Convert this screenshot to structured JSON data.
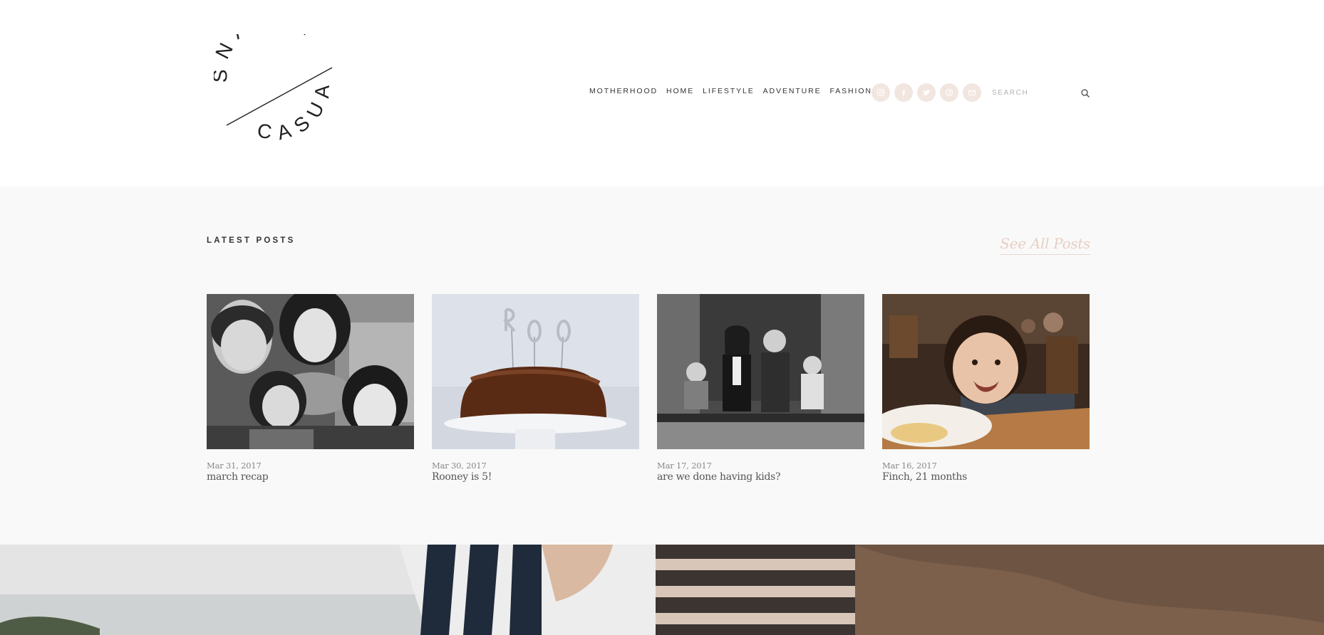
{
  "header": {
    "logo": {
      "name": "Snappy Casual",
      "text_top": "SNAPPY",
      "text_bottom": "CASUAL"
    },
    "nav": [
      {
        "label": "MOTHERHOOD"
      },
      {
        "label": "HOME"
      },
      {
        "label": "LIFESTYLE"
      },
      {
        "label": "ADVENTURE"
      },
      {
        "label": "FASHION"
      }
    ],
    "socials": [
      {
        "icon": "instagram-icon"
      },
      {
        "icon": "facebook-icon"
      },
      {
        "icon": "twitter-icon"
      },
      {
        "icon": "pinterest-icon"
      },
      {
        "icon": "email-icon"
      }
    ],
    "search": {
      "placeholder": "SEARCH",
      "icon": "search-icon"
    }
  },
  "latest": {
    "title": "LATEST POSTS",
    "see_all": "See All Posts",
    "posts": [
      {
        "date": "Mar 31, 2017",
        "title": "march recap",
        "image": "family-selfie-bw"
      },
      {
        "date": "Mar 30, 2017",
        "title": "Rooney is 5!",
        "image": "cake-roo-candles"
      },
      {
        "date": "Mar 17, 2017",
        "title": "are we done having kids?",
        "image": "family-on-bench-bw"
      },
      {
        "date": "Mar 16, 2017",
        "title": "Finch, 21 months",
        "image": "toddler-restaurant"
      }
    ]
  },
  "hero": {
    "image": "striped-shirt-closeup"
  },
  "colors": {
    "accent": "#e8cfc3",
    "social_bg": "#f2e6e0",
    "section_bg": "#f9f9f9"
  }
}
